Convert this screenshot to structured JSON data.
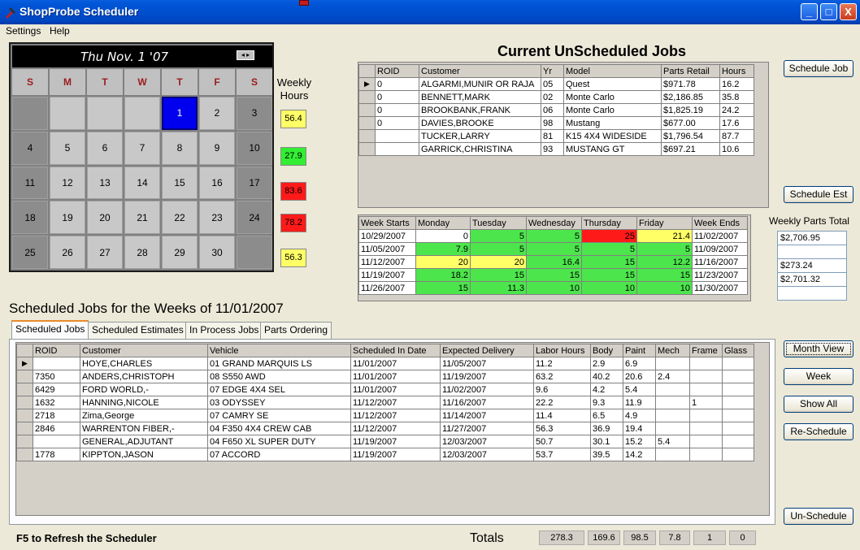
{
  "window": {
    "title": "ShopProbe Scheduler",
    "minimize": "_",
    "maximize": "□",
    "close": "X"
  },
  "menu": [
    "Settings",
    "Help"
  ],
  "calendar": {
    "date_label": "Thu Nov. 1 '07",
    "nav": "◂ ▸",
    "days_of_week": [
      "S",
      "M",
      "T",
      "W",
      "T",
      "F",
      "S"
    ],
    "weeks": [
      [
        "",
        "",
        "",
        "",
        "1",
        "2",
        "3"
      ],
      [
        "4",
        "5",
        "6",
        "7",
        "8",
        "9",
        "10"
      ],
      [
        "11",
        "12",
        "13",
        "14",
        "15",
        "16",
        "17"
      ],
      [
        "18",
        "19",
        "20",
        "21",
        "22",
        "23",
        "24"
      ],
      [
        "25",
        "26",
        "27",
        "28",
        "29",
        "30",
        ""
      ]
    ],
    "today": "1"
  },
  "weekly_hours": {
    "label": "Weekly Hours",
    "values": [
      {
        "value": "56.4",
        "color": "#ffff66"
      },
      {
        "value": "27.9",
        "color": "#33ee33"
      },
      {
        "value": "83.6",
        "color": "#ff1a1a"
      },
      {
        "value": "78.2",
        "color": "#ff1a1a"
      },
      {
        "value": "56.3",
        "color": "#ffff66"
      }
    ]
  },
  "unscheduled": {
    "title": "Current UnScheduled Jobs",
    "columns": [
      "ROID",
      "Customer",
      "Yr",
      "Model",
      "Parts Retail",
      "Hours"
    ],
    "rows": [
      [
        "0",
        "ALGARMI,MUNIR OR RAJA",
        "05",
        "Quest",
        "$971.78",
        "16.2"
      ],
      [
        "0",
        "BENNETT,MARK",
        "02",
        "Monte Carlo",
        "$2,186.85",
        "35.8"
      ],
      [
        "0",
        "BROOKBANK,FRANK",
        "06",
        "Monte Carlo",
        "$1,825.19",
        "24.2"
      ],
      [
        "0",
        "DAVIES,BROOKE",
        "98",
        "Mustang",
        "$677.00",
        "17.6"
      ],
      [
        "",
        "TUCKER,LARRY",
        "81",
        "K15 4X4 WIDESIDE",
        "$1,796.54",
        "87.7"
      ],
      [
        "",
        "GARRICK,CHRISTINA",
        "93",
        "MUSTANG GT",
        "$697.21",
        "10.6"
      ]
    ]
  },
  "week_grid": {
    "columns": [
      "Week Starts",
      "Monday",
      "Tuesday",
      "Wednesday",
      "Thursday",
      "Friday",
      "Week Ends"
    ],
    "rows": [
      {
        "start": "10/29/2007",
        "days": [
          "0",
          "5",
          "5",
          "25",
          "21.4"
        ],
        "colors": [
          "w",
          "g",
          "g",
          "r",
          "y"
        ],
        "end": "11/02/2007"
      },
      {
        "start": "11/05/2007",
        "days": [
          "7.9",
          "5",
          "5",
          "5",
          "5"
        ],
        "colors": [
          "g",
          "g",
          "g",
          "g",
          "g"
        ],
        "end": "11/09/2007"
      },
      {
        "start": "11/12/2007",
        "days": [
          "20",
          "20",
          "16.4",
          "15",
          "12.2"
        ],
        "colors": [
          "y",
          "y",
          "g",
          "g",
          "g"
        ],
        "end": "11/16/2007"
      },
      {
        "start": "11/19/2007",
        "days": [
          "18.2",
          "15",
          "15",
          "15",
          "15"
        ],
        "colors": [
          "g",
          "g",
          "g",
          "g",
          "g"
        ],
        "end": "11/23/2007"
      },
      {
        "start": "11/26/2007",
        "days": [
          "15",
          "11.3",
          "10",
          "10",
          "10"
        ],
        "colors": [
          "g",
          "g",
          "g",
          "g",
          "g"
        ],
        "end": "11/30/2007"
      }
    ]
  },
  "weekly_parts_total": {
    "label": "Weekly Parts Total",
    "values": [
      "$2,706.95",
      "",
      "$273.24",
      "$2,701.32",
      ""
    ]
  },
  "scheduled": {
    "title": "Scheduled Jobs for the Weeks of 11/01/2007",
    "tabs": [
      "Scheduled Jobs",
      "Scheduled Estimates",
      "In Process Jobs",
      "Parts Ordering"
    ],
    "columns": [
      "ROID",
      "Customer",
      "Vehicle",
      "Scheduled In Date",
      "Expected Delivery",
      "Labor Hours",
      "Body",
      "Paint",
      "Mech",
      "Frame",
      "Glass"
    ],
    "rows": [
      [
        "",
        "HOYE,CHARLES",
        "01 GRAND MARQUIS LS",
        "11/01/2007",
        "11/05/2007",
        "11.2",
        "2.9",
        "6.9",
        "",
        "",
        ""
      ],
      [
        "7350",
        "ANDERS,CHRISTOPH",
        "08 S550 AWD",
        "11/01/2007",
        "11/19/2007",
        "63.2",
        "40.2",
        "20.6",
        "2.4",
        "",
        ""
      ],
      [
        "6429",
        "FORD WORLD,-",
        "07 EDGE 4X4 SEL",
        "11/01/2007",
        "11/02/2007",
        "9.6",
        "4.2",
        "5.4",
        "",
        "",
        ""
      ],
      [
        "1632",
        "HANNING,NICOLE",
        "03 ODYSSEY",
        "11/12/2007",
        "11/16/2007",
        "22.2",
        "9.3",
        "11.9",
        "",
        "1",
        ""
      ],
      [
        "2718",
        "Zima,George",
        "07 CAMRY SE",
        "11/12/2007",
        "11/14/2007",
        "11.4",
        "6.5",
        "4.9",
        "",
        "",
        ""
      ],
      [
        "2846",
        "WARRENTON FIBER,-",
        "04 F350 4X4 CREW CAB",
        "11/12/2007",
        "11/27/2007",
        "56.3",
        "36.9",
        "19.4",
        "",
        "",
        ""
      ],
      [
        "",
        "GENERAL,ADJUTANT",
        "04 F650 XL SUPER DUTY",
        "11/19/2007",
        "12/03/2007",
        "50.7",
        "30.1",
        "15.2",
        "5.4",
        "",
        ""
      ],
      [
        "1778",
        "KIPPTON,JASON",
        "07 ACCORD",
        "11/19/2007",
        "12/03/2007",
        "53.7",
        "39.5",
        "14.2",
        "",
        "",
        ""
      ]
    ]
  },
  "buttons": {
    "schedule_job": "Schedule Job",
    "schedule_est": "Schedule Est",
    "month_view": "Month View",
    "week": "Week",
    "show_all": "Show All",
    "reschedule": "Re-Schedule",
    "unschedule": "Un-Schedule"
  },
  "footer": {
    "refresh_hint": "F5 to Refresh the Scheduler",
    "totals_label": "Totals",
    "totals": [
      "278.3",
      "169.6",
      "98.5",
      "7.8",
      "1",
      "0"
    ]
  }
}
